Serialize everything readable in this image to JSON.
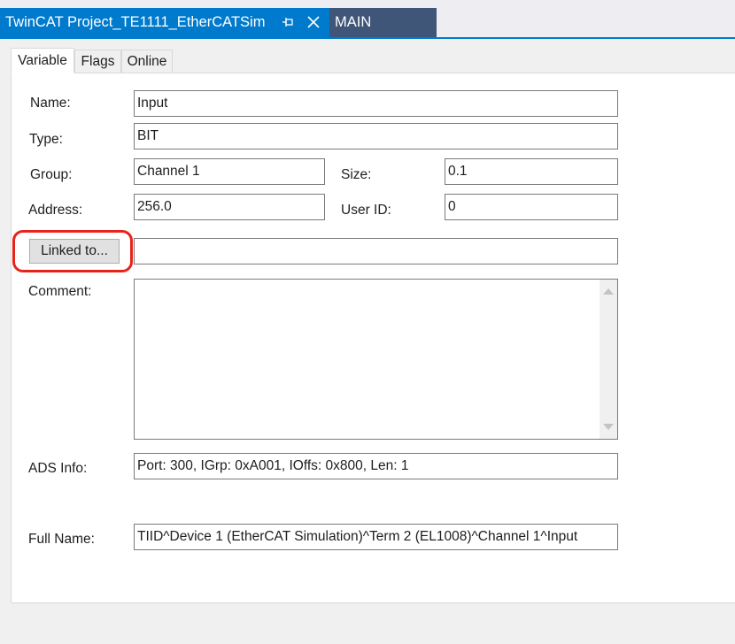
{
  "window": {
    "active_tab_title": "TwinCAT Project_TE1111_EtherCATSim",
    "inactive_tab_title": "MAIN"
  },
  "tabs": [
    "Variable",
    "Flags",
    "Online"
  ],
  "labels": {
    "name": "Name:",
    "type": "Type:",
    "group": "Group:",
    "size": "Size:",
    "address": "Address:",
    "user_id": "User ID:",
    "comment": "Comment:",
    "ads_info": "ADS Info:",
    "full_name": "Full Name:"
  },
  "fields": {
    "name": "Input",
    "type": "BIT",
    "group": "Channel 1",
    "size": "0.1",
    "address": "256.0",
    "user_id": "0",
    "linked_to": "",
    "comment": "",
    "ads_info": "Port: 300, IGrp: 0xA001, IOffs: 0x800, Len: 1",
    "full_name": "TIID^Device 1 (EtherCAT Simulation)^Term 2 (EL1008)^Channel 1^Input"
  },
  "buttons": {
    "linked_to": "Linked to..."
  },
  "colors": {
    "active_tab": "#007acc",
    "inactive_tab": "#3f5678",
    "highlight": "#e8231a"
  }
}
